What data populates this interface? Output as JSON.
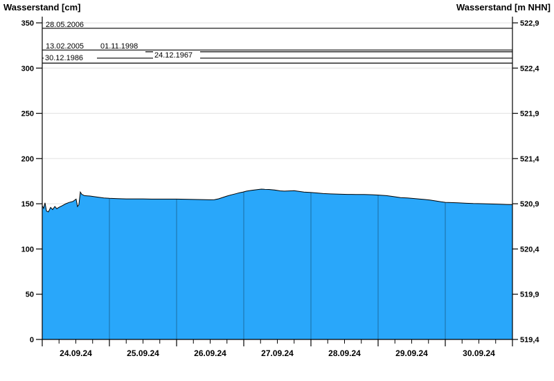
{
  "header": {
    "left_title": "Wasserstand [cm]",
    "right_title": "Wasserstand [m NHN]"
  },
  "chart_data": {
    "type": "area",
    "title": "",
    "left_axis": {
      "label": "Wasserstand [cm]",
      "ticks": [
        350,
        300,
        250,
        200,
        150,
        100,
        50,
        0
      ],
      "range": [
        0,
        350
      ]
    },
    "right_axis": {
      "label": "Wasserstand [m NHN]",
      "tick_labels": [
        "522,9",
        "522,4",
        "521,9",
        "521,4",
        "520,9",
        "520,4",
        "519,9",
        "519,4"
      ],
      "range": [
        519.4,
        522.9
      ]
    },
    "x_axis": {
      "tick_labels": [
        "24.09.24",
        "25.09.24",
        "26.09.24",
        "27.09.24",
        "28.09.24",
        "29.09.24",
        "30.09.24"
      ],
      "days": 7,
      "minor_ticks_per_day": 4,
      "x_unit": "hours since 24.09.24 00:00",
      "x_range_hours": [
        0,
        168
      ]
    },
    "grid": {
      "horizontal": true,
      "vertical_day_lines_in_area": true
    },
    "reference_lines": [
      {
        "label": "28.05.2006",
        "value_cm": 344
      },
      {
        "label": "13.02.2005",
        "value_cm": 320
      },
      {
        "label": "01.11.1998",
        "value_cm": 318
      },
      {
        "label": "24.12.1967",
        "value_cm": 311
      },
      {
        "label": "30.12.1986",
        "value_cm": 305.5
      }
    ],
    "series": [
      {
        "name": "Wasserstand",
        "unit": "cm",
        "points": [
          [
            0,
            148
          ],
          [
            0.5,
            145
          ],
          [
            1,
            151
          ],
          [
            1.5,
            142
          ],
          [
            2.2,
            141
          ],
          [
            3,
            146
          ],
          [
            3.7,
            143.5
          ],
          [
            4.5,
            147
          ],
          [
            5.2,
            144.5
          ],
          [
            5.9,
            146
          ],
          [
            7.2,
            148
          ],
          [
            8.4,
            150
          ],
          [
            9.6,
            151.5
          ],
          [
            10.9,
            152.5
          ],
          [
            11.6,
            154
          ],
          [
            12.1,
            155.2
          ],
          [
            12.6,
            147
          ],
          [
            13.1,
            149
          ],
          [
            13.6,
            163
          ],
          [
            14.1,
            160.5
          ],
          [
            15.1,
            159
          ],
          [
            17.1,
            158.5
          ],
          [
            19.5,
            157.5
          ],
          [
            22,
            156.5
          ],
          [
            24,
            156
          ],
          [
            27,
            155.6
          ],
          [
            30,
            155.4
          ],
          [
            33,
            155.4
          ],
          [
            36,
            155.4
          ],
          [
            39,
            155.2
          ],
          [
            42,
            155.2
          ],
          [
            45,
            155.2
          ],
          [
            48,
            155.2
          ],
          [
            51,
            155
          ],
          [
            54,
            154.8
          ],
          [
            57,
            154.6
          ],
          [
            60,
            154.4
          ],
          [
            61.5,
            154.5
          ],
          [
            63,
            155.5
          ],
          [
            64.5,
            157
          ],
          [
            66,
            158.5
          ],
          [
            67.5,
            159.8
          ],
          [
            69,
            161
          ],
          [
            70.5,
            162.2
          ],
          [
            71.7,
            163
          ],
          [
            73,
            164
          ],
          [
            75,
            165
          ],
          [
            77,
            165.7
          ],
          [
            78.3,
            166.2
          ],
          [
            79.5,
            166
          ],
          [
            81,
            165.8
          ],
          [
            83,
            165.3
          ],
          [
            85,
            164.3
          ],
          [
            86.5,
            164
          ],
          [
            88,
            164.2
          ],
          [
            90,
            164.4
          ],
          [
            91.5,
            163.8
          ],
          [
            93.5,
            163
          ],
          [
            95.7,
            162.5
          ],
          [
            98,
            162
          ],
          [
            100.4,
            161.3
          ],
          [
            103,
            160.9
          ],
          [
            106,
            160.6
          ],
          [
            109,
            160.4
          ],
          [
            112,
            160.3
          ],
          [
            115,
            160.2
          ],
          [
            118,
            160
          ],
          [
            120.2,
            159.6
          ],
          [
            123,
            159
          ],
          [
            125.5,
            158
          ],
          [
            128,
            156.8
          ],
          [
            130.5,
            156.4
          ],
          [
            133,
            155.8
          ],
          [
            135,
            155.2
          ],
          [
            136.5,
            154.8
          ],
          [
            138.5,
            154.2
          ],
          [
            140.5,
            153.2
          ],
          [
            142.5,
            152.2
          ],
          [
            144,
            151.6
          ],
          [
            146,
            151.3
          ],
          [
            148.5,
            151
          ],
          [
            151.5,
            150.6
          ],
          [
            154,
            150.3
          ],
          [
            157,
            150.1
          ],
          [
            160,
            149.8
          ],
          [
            163,
            149.5
          ],
          [
            166,
            149.2
          ],
          [
            168,
            149
          ]
        ]
      }
    ],
    "colors": {
      "area_fill": "#29A7FA",
      "area_outline": "#000000",
      "gridline": "#E0E0E0",
      "axis": "#000000",
      "reference_line": "#000000"
    }
  }
}
